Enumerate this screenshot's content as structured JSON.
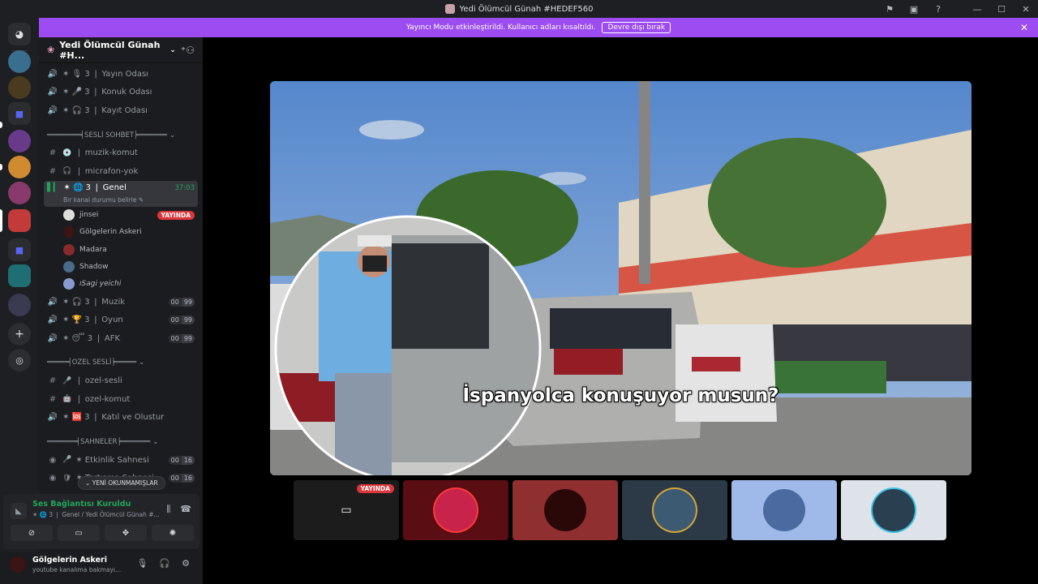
{
  "window": {
    "title": "Yedi Ölümcül Günah #HEDEF560",
    "controls": [
      "—",
      "☐",
      "✕"
    ]
  },
  "banner": {
    "text": "Yayıncı Modu etkinleştirildi. Kullanıcı adları kısaltıldı.",
    "button": "Devre dışı bırak"
  },
  "server": {
    "name": "Yedi Ölümcül Günah #H..."
  },
  "channels": {
    "top": [
      {
        "icon": "speaker",
        "text": "✶ 🎙 3 ❘ Yayın Odası"
      },
      {
        "icon": "speaker",
        "text": "✶ 🎤 3 ❘ Konuk Odası"
      },
      {
        "icon": "speaker",
        "text": "✶ 🎧 3 ❘ Kayıt Odası"
      }
    ],
    "cat_sesli": "════════╡SESLİ SOHBET╞═══════",
    "sesli": [
      {
        "icon": "#",
        "text": "❘ muzik-komut"
      },
      {
        "icon": "#",
        "text": "❘ micrafon-yok"
      }
    ],
    "active": {
      "name": "✶ 🌐 3 ❘ Genel",
      "time": "37:03",
      "status": "Bir kanal durumu belirle"
    },
    "members": [
      {
        "name": "jinsei",
        "live": "YAYINDA"
      },
      {
        "name": "Gölgelerin Askeri"
      },
      {
        "name": "Madara"
      },
      {
        "name": "Shadow"
      },
      {
        "name": "ıSagi yeichi"
      }
    ],
    "after": [
      {
        "icon": "speaker",
        "text": "✶ 🎧 3 ❘ Muzik",
        "c1": "00",
        "c2": "99"
      },
      {
        "icon": "speaker",
        "text": "✶ 🏆 3 ❘ Oyun",
        "c1": "00",
        "c2": "99"
      },
      {
        "icon": "speaker",
        "text": "✶ 😴 3 ❘ AFK",
        "c1": "00",
        "c2": "99"
      }
    ],
    "cat_ozel": "═════╡OZEL SESLİ╞═════",
    "ozel": [
      {
        "icon": "#",
        "text": "❘ ozel-sesli"
      },
      {
        "icon": "#",
        "text": "❘ ozel-komut"
      },
      {
        "icon": "speaker",
        "text": "✶ 🆘 3 ❘ Katıl ve Olustur"
      }
    ],
    "cat_sahne": "═══════╡SAHNELER╞═══════",
    "sahne": [
      {
        "icon": "stage",
        "text": "✶ Etkinlik Sahnesi",
        "c1": "00",
        "c2": "16"
      },
      {
        "icon": "stage",
        "text": "✶ Tartışma Sahnesi",
        "c1": "00",
        "c2": "16"
      }
    ],
    "unread": "YENİ OKUNMAMIŞLAR"
  },
  "voice": {
    "title": "Ses Bağlantısı Kuruldu",
    "sub": "✶ 🌐 3 ❘ Genel / Yedi Ölümcül Günah #..."
  },
  "user": {
    "name": "Gölgelerin Askeri",
    "status": "youtube kanalıma bakmayı..."
  },
  "stream": {
    "subtitle": "İspanyolca konuşuyor musun?",
    "tile_live": "YAYINDA"
  },
  "colors": {
    "accent": "#9c4cf0",
    "green": "#23a55a",
    "live": "#da373c"
  }
}
